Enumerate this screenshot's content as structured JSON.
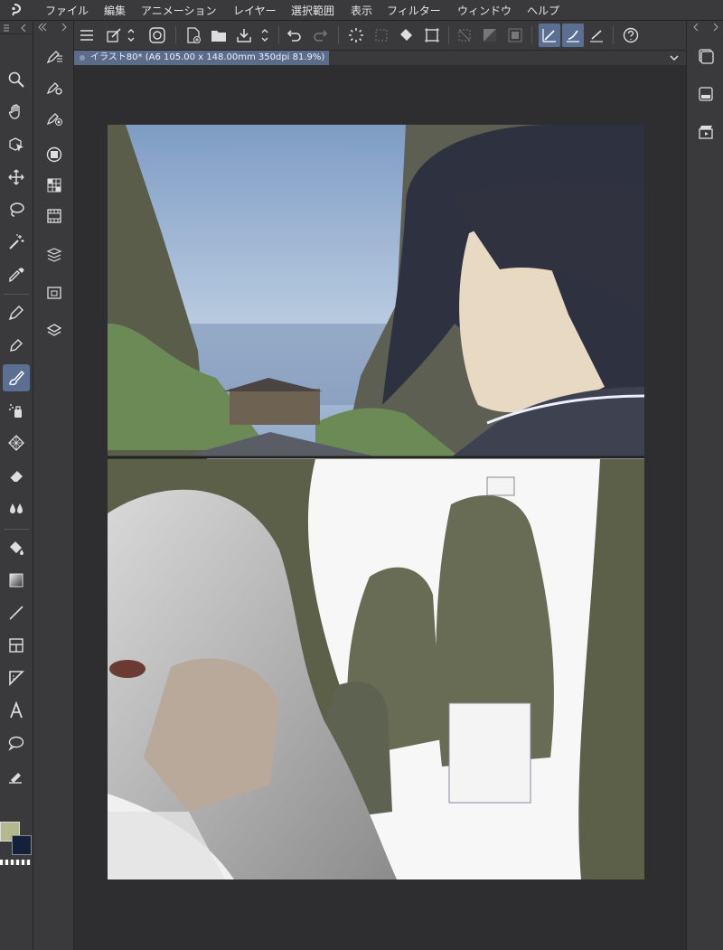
{
  "menu": {
    "items": [
      "ファイル",
      "編集",
      "アニメーション",
      "レイヤー",
      "選択範囲",
      "表示",
      "フィルター",
      "ウィンドウ",
      "ヘルプ"
    ]
  },
  "document": {
    "tab_title": "イラスト80* (A6 105.00 x 148.00mm 350dpi 81.9%)"
  },
  "left_toolbar": {
    "tools": [
      "menu-icon",
      "zoom-icon",
      "hand-icon",
      "object-icon",
      "move-icon",
      "lasso-select-icon",
      "magic-wand-icon",
      "eyedropper-icon",
      "pen-icon",
      "pencil-icon",
      "brush-icon",
      "airbrush-icon",
      "decoration-icon",
      "eraser-icon",
      "blend-icon",
      "fill-icon",
      "gradient-icon",
      "line-icon",
      "frame-icon",
      "ruler-icon",
      "text-icon",
      "balloon-icon",
      "correction-line-icon"
    ],
    "active_tool": "brush-icon",
    "main_color": "#b3b88f",
    "sub_color": "#14213d"
  },
  "colors": {
    "accent": "#5a6f92",
    "panel": "#3a3a3c",
    "canvas_bg": "#2e2e30"
  }
}
